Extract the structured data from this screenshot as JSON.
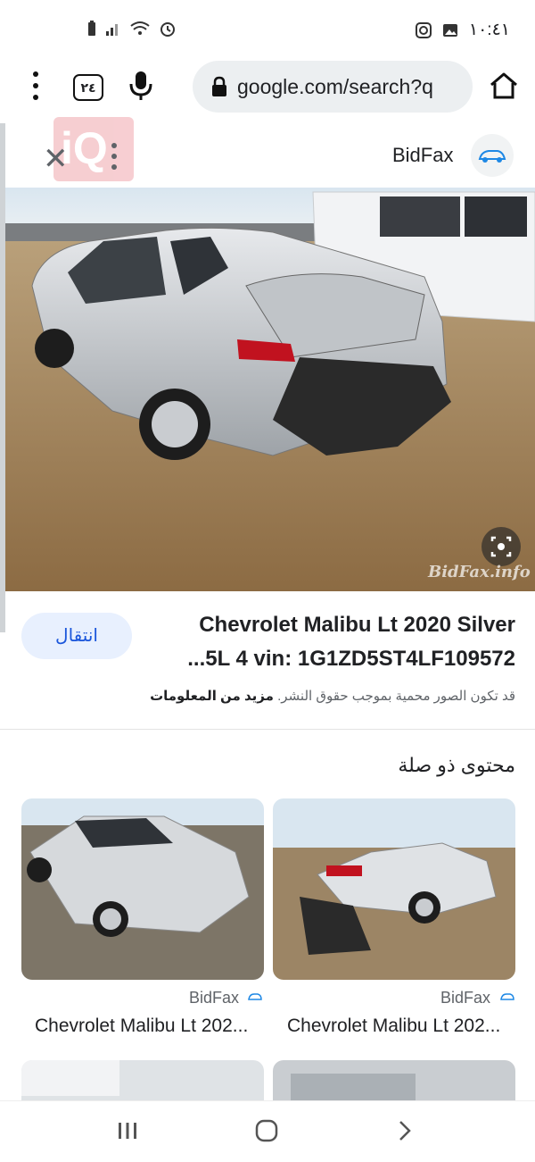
{
  "status_bar": {
    "time": "١٠:٤١",
    "icons": [
      "battery-icon",
      "signal-icon",
      "wifi-icon",
      "alarm-icon",
      "instagram-icon",
      "gallery-icon"
    ]
  },
  "browser": {
    "tab_count": "٢٤",
    "url": "google.com/search?q"
  },
  "viewer": {
    "site_name": "BidFax",
    "image_watermark": "BidFax.info",
    "visit_button": "انتقال",
    "title_line1": "Chevrolet Malibu Lt 2020 Silver",
    "title_line2": "...5L 4 vin: 1G1ZD5ST4LF109572",
    "copyright_text": "قد تكون الصور محمية بموجب حقوق النشر.",
    "more_info": "مزيد من المعلومات"
  },
  "related": {
    "heading": "محتوى ذو صلة",
    "cards": [
      {
        "source": "BidFax",
        "title": "Chevrolet Malibu Lt 202..."
      },
      {
        "source": "BidFax",
        "title": "Chevrolet Malibu Lt 202..."
      }
    ]
  },
  "colors": {
    "accent": "#1a56db",
    "visit_bg": "#e8f0fe",
    "url_bg": "#eceff1"
  }
}
